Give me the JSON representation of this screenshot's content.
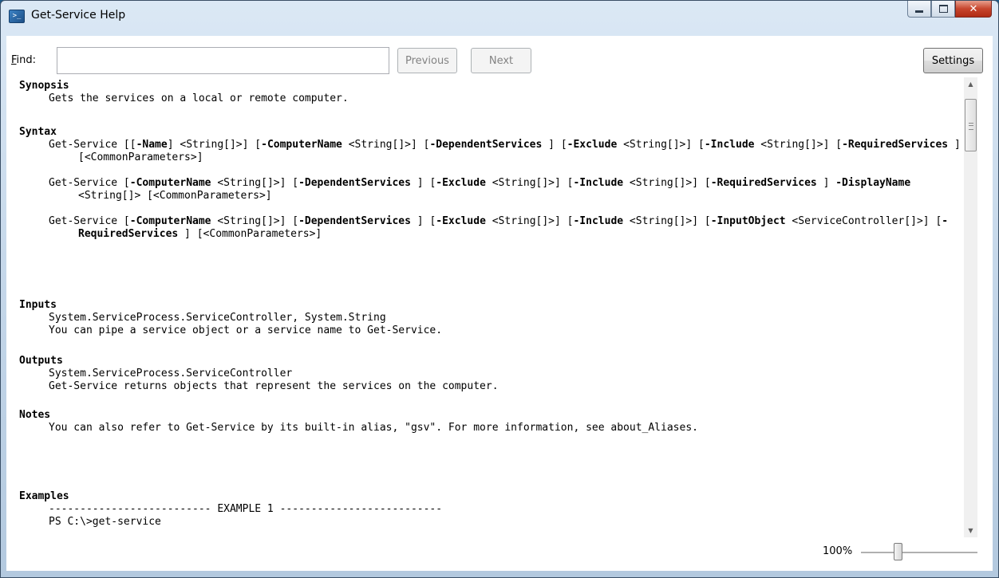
{
  "window": {
    "title": "Get-Service Help",
    "icon": "powershell-icon"
  },
  "findbar": {
    "label": "Find:",
    "value": "",
    "previous": "Previous",
    "next": "Next",
    "settings": "Settings"
  },
  "help": {
    "synopsis": {
      "title": "Synopsis",
      "text": "Gets the services on a local or remote computer."
    },
    "syntax": {
      "title": "Syntax",
      "lines": [
        [
          {
            "t": "Get-Service [[",
            "b": false
          },
          {
            "t": "-Name",
            "b": true
          },
          {
            "t": "] <String[]>] [",
            "b": false
          },
          {
            "t": "-ComputerName",
            "b": true
          },
          {
            "t": " <String[]>] [",
            "b": false
          },
          {
            "t": "-DependentServices",
            "b": true
          },
          {
            "t": " ] [",
            "b": false
          },
          {
            "t": "-Exclude",
            "b": true
          },
          {
            "t": " <String[]>] [",
            "b": false
          },
          {
            "t": "-Include",
            "b": true
          },
          {
            "t": " <String[]>] [",
            "b": false
          },
          {
            "t": "-RequiredServices",
            "b": true
          },
          {
            "t": " ] [<CommonParameters>]",
            "b": false
          }
        ],
        [
          {
            "t": "Get-Service [",
            "b": false
          },
          {
            "t": "-ComputerName",
            "b": true
          },
          {
            "t": " <String[]>] [",
            "b": false
          },
          {
            "t": "-DependentServices",
            "b": true
          },
          {
            "t": " ] [",
            "b": false
          },
          {
            "t": "-Exclude",
            "b": true
          },
          {
            "t": " <String[]>] [",
            "b": false
          },
          {
            "t": "-Include",
            "b": true
          },
          {
            "t": " <String[]>] [",
            "b": false
          },
          {
            "t": "-RequiredServices",
            "b": true
          },
          {
            "t": " ] ",
            "b": false
          },
          {
            "t": "-DisplayName",
            "b": true
          },
          {
            "t": " <String[]> [<CommonParameters>]",
            "b": false
          }
        ],
        [
          {
            "t": "Get-Service [",
            "b": false
          },
          {
            "t": "-ComputerName",
            "b": true
          },
          {
            "t": " <String[]>] [",
            "b": false
          },
          {
            "t": "-DependentServices",
            "b": true
          },
          {
            "t": " ] [",
            "b": false
          },
          {
            "t": "-Exclude",
            "b": true
          },
          {
            "t": " <String[]>] [",
            "b": false
          },
          {
            "t": "-Include",
            "b": true
          },
          {
            "t": " <String[]>] [",
            "b": false
          },
          {
            "t": "-InputObject",
            "b": true
          },
          {
            "t": " <ServiceController[]>] [",
            "b": false
          },
          {
            "t": "-RequiredServices",
            "b": true
          },
          {
            "t": " ] [<CommonParameters>]",
            "b": false
          }
        ]
      ]
    },
    "inputs": {
      "title": "Inputs",
      "lines": [
        "System.ServiceProcess.ServiceController, System.String",
        "You can pipe a service object or a service name to Get-Service."
      ]
    },
    "outputs": {
      "title": "Outputs",
      "lines": [
        "System.ServiceProcess.ServiceController",
        "Get-Service returns objects that represent the services on the computer."
      ]
    },
    "notes": {
      "title": "Notes",
      "text": "You can also refer to Get-Service by its built-in alias, \"gsv\". For more information, see about_Aliases."
    },
    "examples": {
      "title": "Examples",
      "lines": [
        "-------------------------- EXAMPLE 1 --------------------------",
        "PS C:\\>get-service"
      ]
    }
  },
  "zoom": {
    "label": "100%",
    "value": 100
  }
}
